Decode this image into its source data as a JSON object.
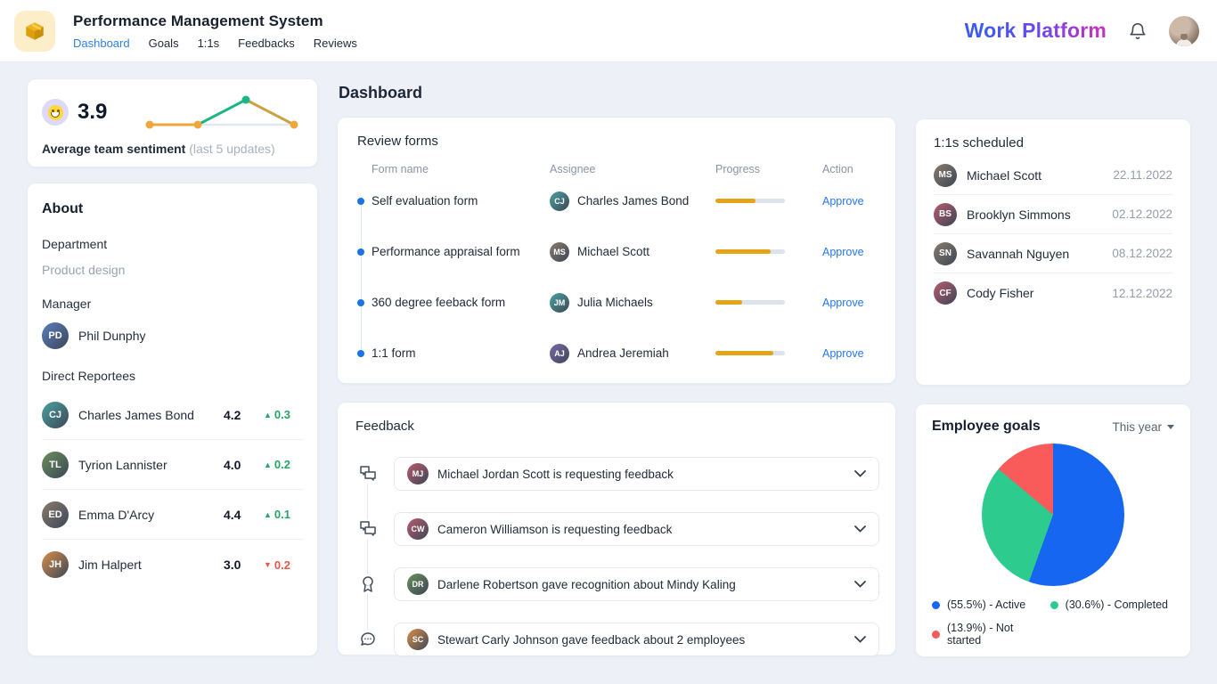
{
  "colors": {
    "accent_blue": "#2f80ed",
    "link_blue": "#2676f5",
    "progress_amber": "#e5a417",
    "delta_green": "#27a567",
    "delta_red": "#e8554d",
    "pie_blue": "#1766f2",
    "pie_green": "#2dcb8e",
    "pie_red": "#f95a5a",
    "spark_orange": "#eda73c",
    "spark_green": "#1db584"
  },
  "header": {
    "app_title": "Performance Management System",
    "logo_icon": "package-cube-icon",
    "nav": [
      {
        "label": "Dashboard",
        "active": true
      },
      {
        "label": "Goals",
        "active": false
      },
      {
        "label": "1:1s",
        "active": false
      },
      {
        "label": "Feedbacks",
        "active": false
      },
      {
        "label": "Reviews",
        "active": false
      }
    ],
    "brand": "Work Platform",
    "bell_icon": "notification-bell-icon",
    "avatar": "user-profile-photo"
  },
  "sentiment": {
    "emoji_icon": "grinning-face-emoji",
    "score": "3.9",
    "label": "Average team sentiment",
    "sublabel": "(last 5 updates)"
  },
  "about": {
    "title": "About",
    "department_label": "Department",
    "department_value": "Product design",
    "manager_label": "Manager",
    "manager_name": "Phil Dunphy",
    "reportees_label": "Direct Reportees",
    "reportees": [
      {
        "name": "Charles James Bond",
        "score": "4.2",
        "delta": "0.3",
        "direction": "up"
      },
      {
        "name": "Tyrion Lannister",
        "score": "4.0",
        "delta": "0.2",
        "direction": "up"
      },
      {
        "name": "Emma D'Arcy",
        "score": "4.4",
        "delta": "0.1",
        "direction": "up"
      },
      {
        "name": "Jim Halpert",
        "score": "3.0",
        "delta": "0.2",
        "direction": "down"
      }
    ]
  },
  "main": {
    "page_title": "Dashboard"
  },
  "review_forms": {
    "title": "Review forms",
    "columns": {
      "form": "Form name",
      "assignee": "Assignee",
      "progress": "Progress",
      "action": "Action"
    },
    "rows": [
      {
        "form": "Self evaluation form",
        "assignee": "Charles James Bond",
        "progress": 58,
        "action": "Approve"
      },
      {
        "form": "Performance appraisal form",
        "assignee": "Michael Scott",
        "progress": 79,
        "action": "Approve"
      },
      {
        "form": "360 degree feeback form",
        "assignee": "Julia Michaels",
        "progress": 38,
        "action": "Approve"
      },
      {
        "form": "1:1 form",
        "assignee": "Andrea Jeremiah",
        "progress": 83,
        "action": "Approve"
      }
    ]
  },
  "feedback": {
    "title": "Feedback",
    "items": [
      {
        "icon": "chat-duplicate-icon",
        "person": "Michael Jordan Scott",
        "text": "Michael Jordan Scott is requesting feedback"
      },
      {
        "icon": "chat-duplicate-icon",
        "person": "Cameron Williamson",
        "text": "Cameron Williamson is requesting feedback"
      },
      {
        "icon": "award-ribbon-icon",
        "person": "Darlene Robertson",
        "text": "Darlene Robertson gave recognition about Mindy Kaling"
      },
      {
        "icon": "comment-dots-icon",
        "person": "Stewart Carly Johnson",
        "text": "Stewart Carly Johnson gave feedback about 2 employees"
      }
    ]
  },
  "one_on_ones": {
    "title": "1:1s scheduled",
    "rows": [
      {
        "name": "Michael Scott",
        "date": "22.11.2022"
      },
      {
        "name": "Brooklyn Simmons",
        "date": "02.12.2022"
      },
      {
        "name": "Savannah Nguyen",
        "date": "08.12.2022"
      },
      {
        "name": "Cody Fisher",
        "date": "12.12.2022"
      }
    ]
  },
  "employee_goals": {
    "title": "Employee goals",
    "filter": "This year",
    "slices": [
      {
        "name": "Active",
        "percent": 55.5,
        "legend": "(55.5%) - Active",
        "color": "#1766f2"
      },
      {
        "name": "Completed",
        "percent": 30.6,
        "legend": "(30.6%) - Completed",
        "color": "#2dcb8e"
      },
      {
        "name": "Not started",
        "percent": 13.9,
        "legend": "(13.9%) - Not started",
        "color": "#f95a5a"
      }
    ]
  },
  "chart_data": [
    {
      "type": "line",
      "title": "Average team sentiment (last 5 updates)",
      "x": [
        1,
        2,
        3,
        4
      ],
      "values": [
        3.8,
        3.8,
        4.4,
        3.8
      ],
      "ylim": [
        3.5,
        4.6
      ],
      "grid": false,
      "note": "sparkline; flat orange segment, green rise to peak, orange fall; gray baseline"
    },
    {
      "type": "pie",
      "title": "Employee goals",
      "labels": [
        "Active",
        "Completed",
        "Not started"
      ],
      "values": [
        55.5,
        30.6,
        13.9
      ],
      "colors": [
        "#1766f2",
        "#2dcb8e",
        "#f95a5a"
      ],
      "legend_position": "bottom",
      "start_angle_deg": 0,
      "direction": "clockwise"
    }
  ]
}
